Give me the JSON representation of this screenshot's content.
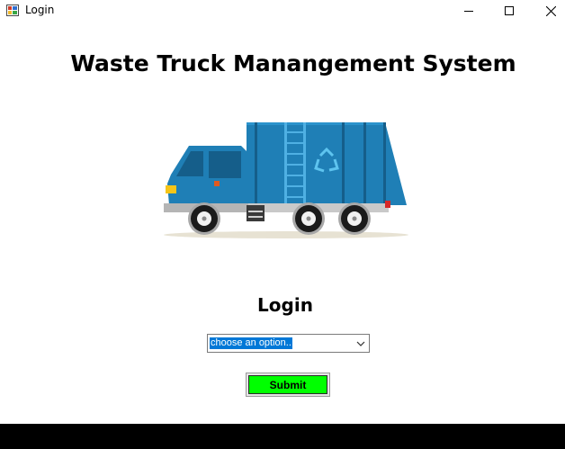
{
  "window": {
    "title": "Login",
    "app_icon": "windows-form-icon",
    "controls": {
      "minimize": "minimize-icon",
      "maximize": "maximize-icon",
      "close": "close-icon"
    }
  },
  "main": {
    "heading": "Waste Truck Manangement System",
    "illustration": "garbage-truck-icon",
    "login_label": "Login",
    "role_select": {
      "value": "choose an option..",
      "icon": "chevron-down-icon"
    },
    "submit_label": "Submit"
  },
  "colors": {
    "truck_body": "#1f7fb6",
    "truck_dark": "#155e8a",
    "submit_green": "#00ff00",
    "selection_blue": "#0078d7"
  }
}
